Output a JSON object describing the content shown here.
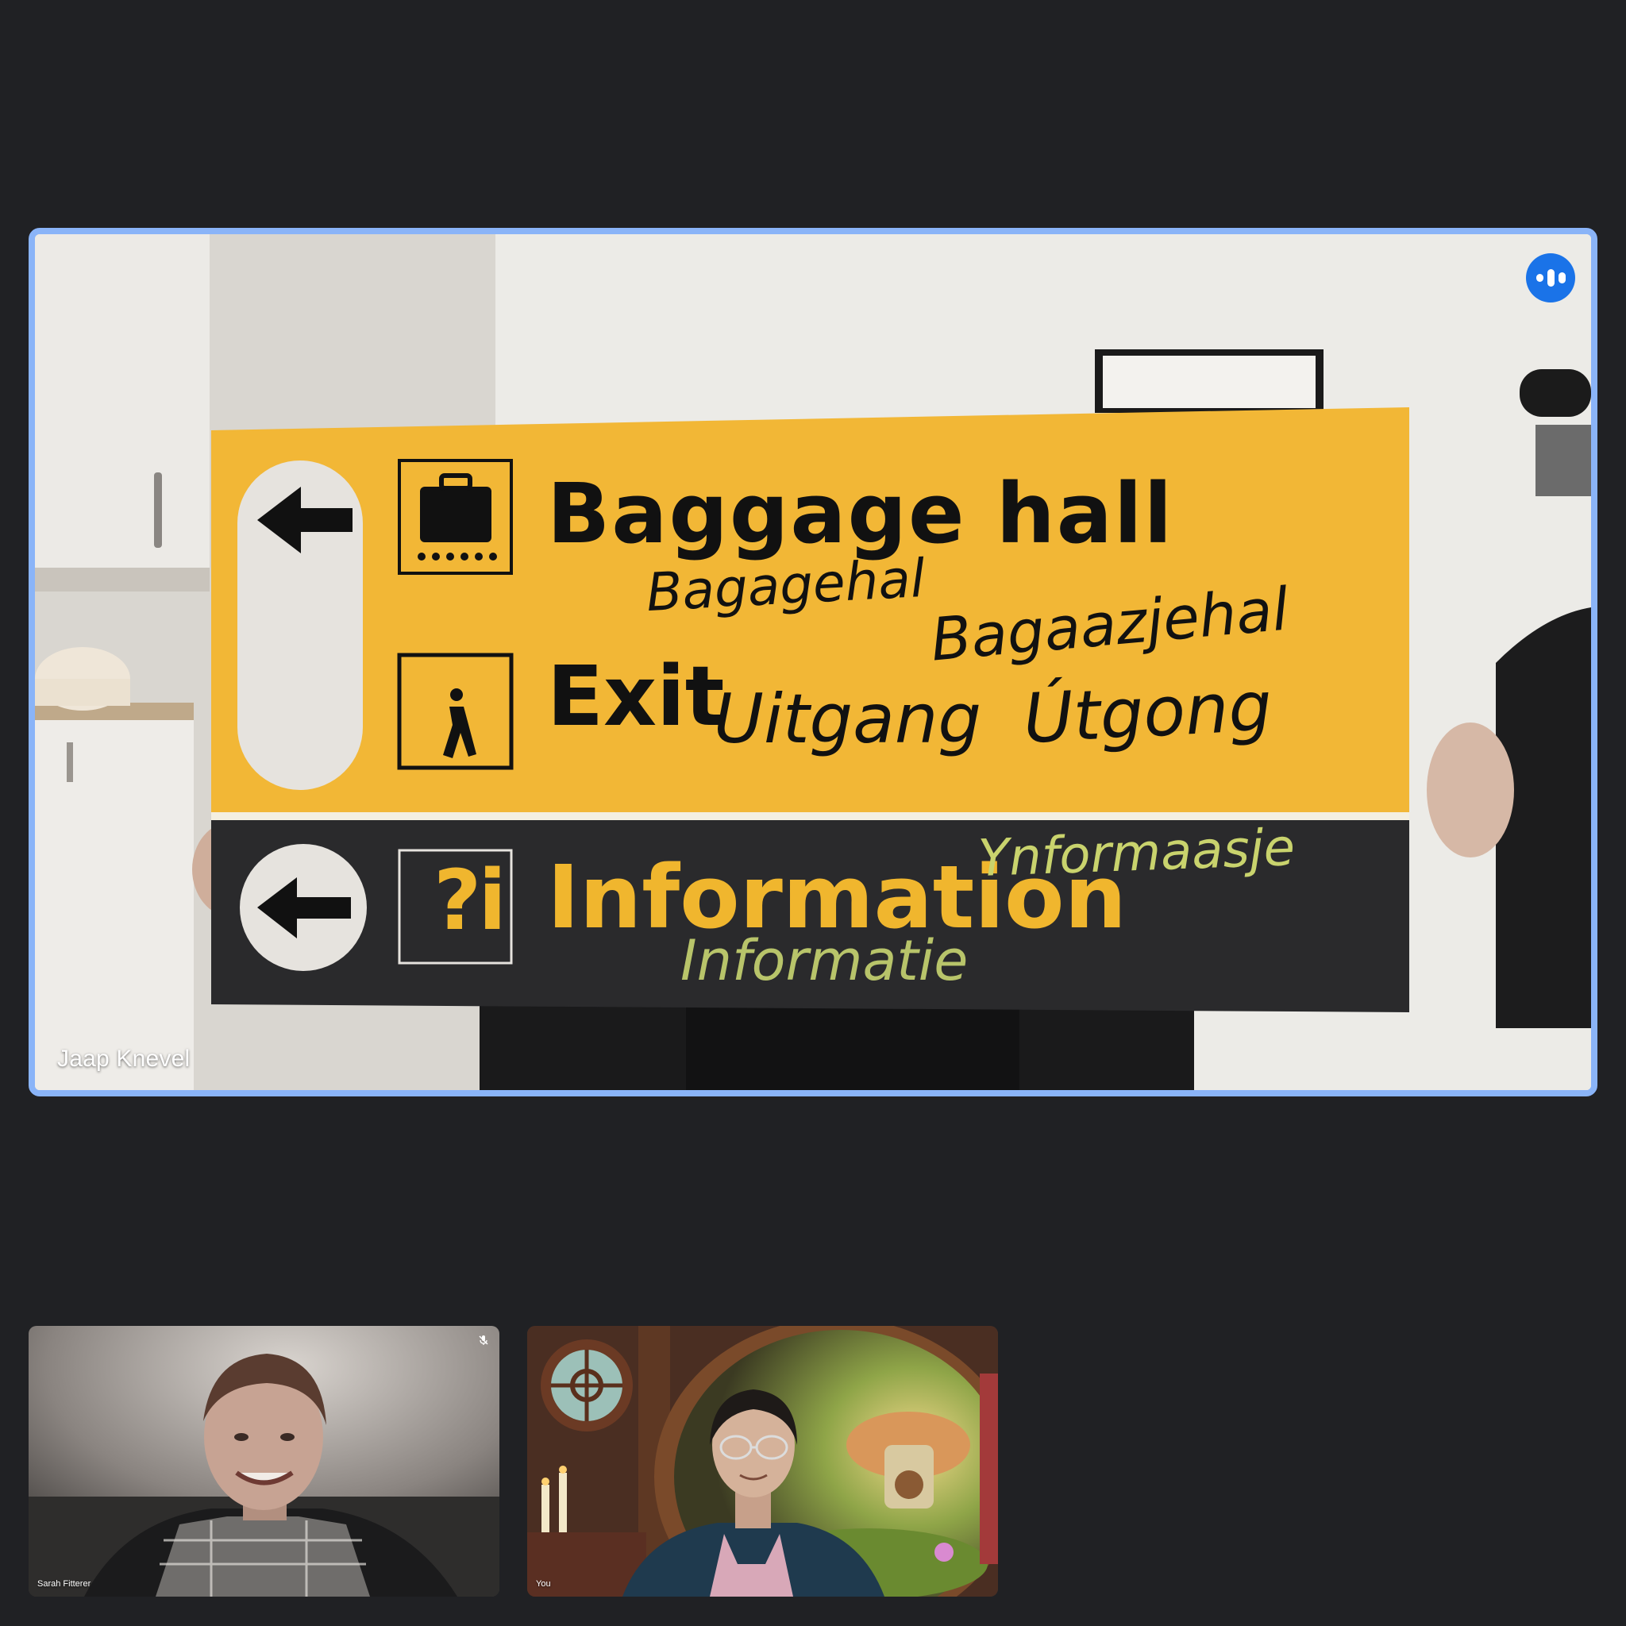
{
  "main_tile": {
    "participant_name": "Jaap Knevel",
    "speaking_icon": "audio-level-icon",
    "highlight_color": "#8ab4f8",
    "speaking_badge_color": "#1a73e8",
    "sign": {
      "baggage_en": "Baggage hall",
      "baggage_fy": "Bagagehal",
      "baggage_nl": "Bagaazjehal",
      "exit_en": "Exit",
      "exit_nl": "Uitgang",
      "exit_fy": "Útgong",
      "info_en": "Information",
      "info_fy": "Ynformaasje",
      "info_nl": "Informatie",
      "info_symbol": "?i",
      "sign_yellow": "#f2b736",
      "sign_dark": "#2a2a2c"
    }
  },
  "tiles": [
    {
      "participant_name": "Sarah Fitterer",
      "muted_icon": "mic-off-icon"
    },
    {
      "participant_name": "You",
      "background": "virtual-background"
    }
  ],
  "page_background": "#202124"
}
